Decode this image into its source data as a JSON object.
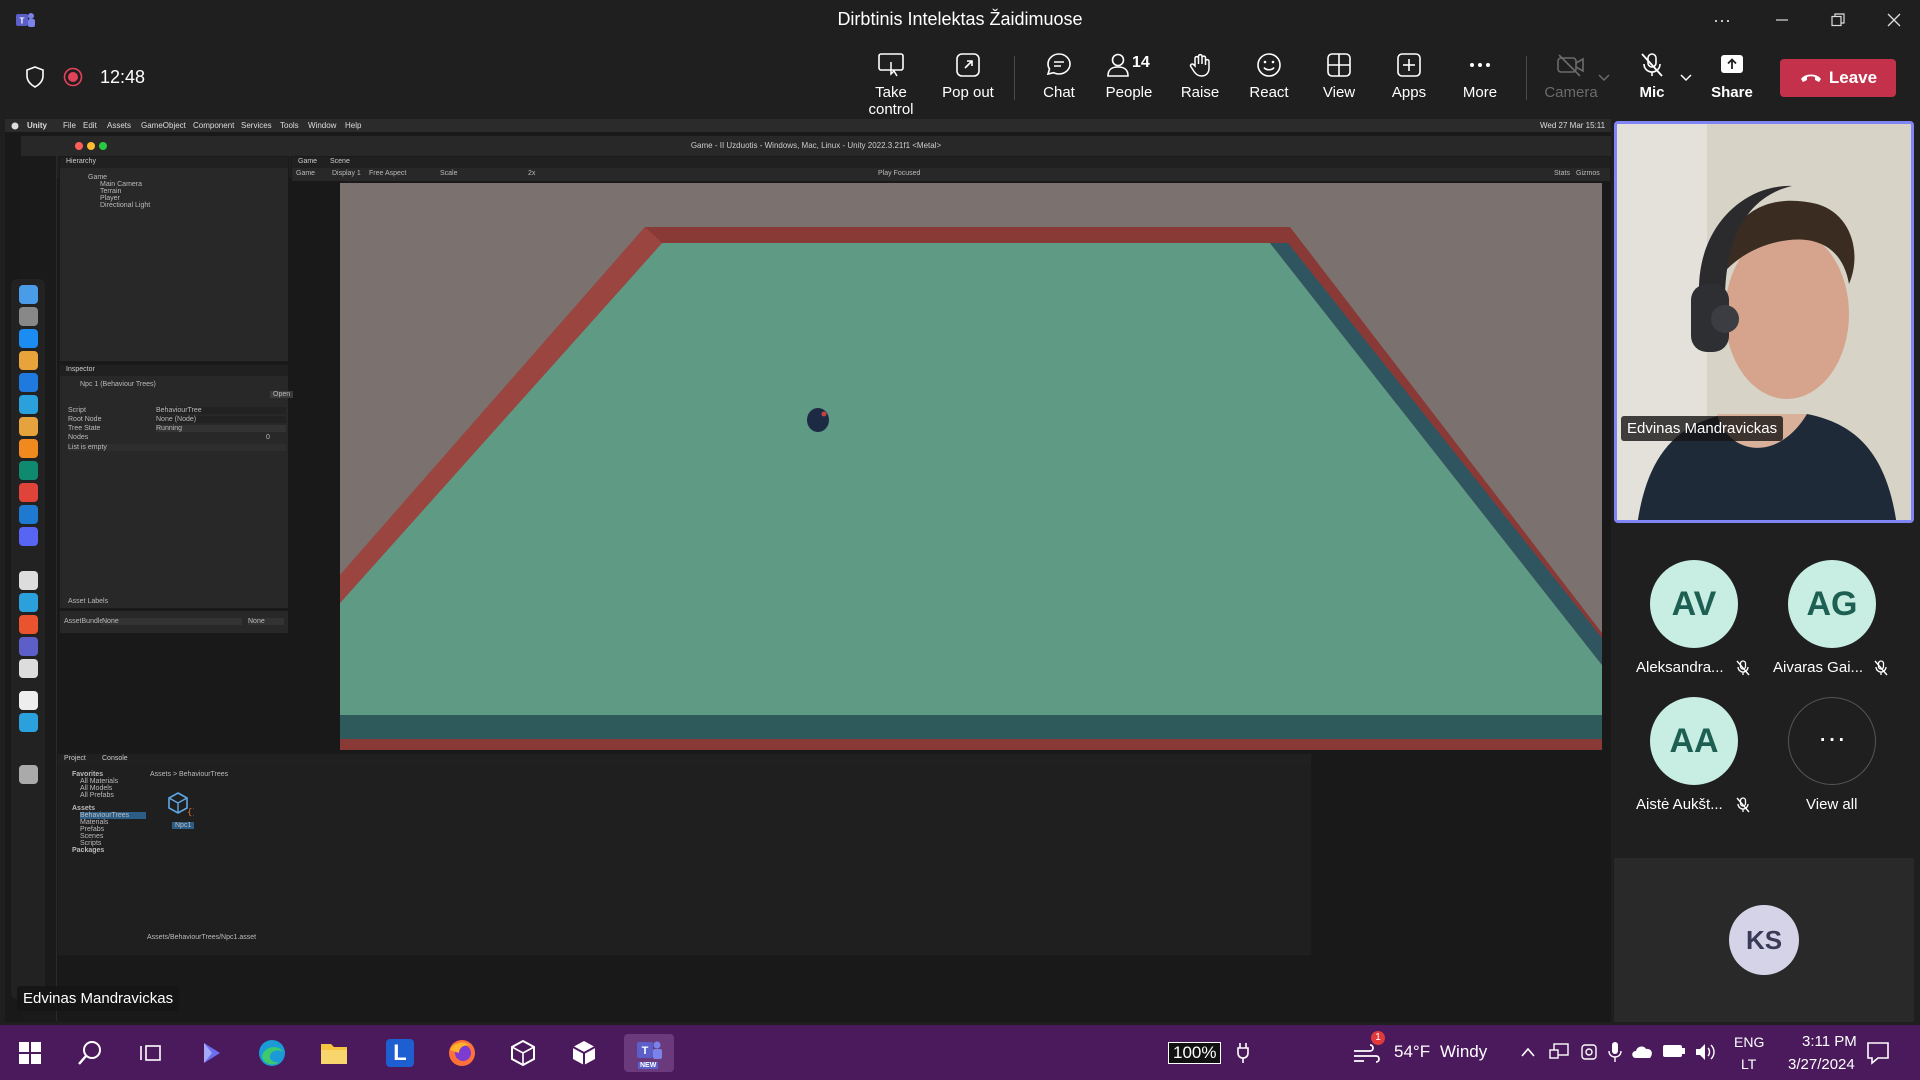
{
  "window": {
    "title": "Dirbtinis Intelektas Žaidimuose",
    "more_label": "···"
  },
  "meeting": {
    "elapsed": "12:48",
    "people_count": "14"
  },
  "toolbar": {
    "take_control": "Take control",
    "pop_out": "Pop out",
    "chat": "Chat",
    "people": "People",
    "raise": "Raise",
    "react": "React",
    "view": "View",
    "apps": "Apps",
    "more": "More",
    "camera": "Camera",
    "mic": "Mic",
    "share": "Share",
    "leave": "Leave"
  },
  "shared_screen": {
    "presenter_name": "Edvinas Mandravickas",
    "mac_menu": [
      "Unity",
      "File",
      "Edit",
      "Assets",
      "GameObject",
      "Component",
      "Services",
      "Tools",
      "Window",
      "Help"
    ],
    "mac_clock": "Wed 27 Mar 15:11",
    "unity_title": "Game - II Uzduotis - Windows, Mac, Linux - Unity 2022.3.21f1 <Metal>",
    "hierarchy_tab": "Hierarchy",
    "hierarchy_items": [
      "Game",
      "Main Camera",
      "Terrain",
      "Player",
      "Directional Light"
    ],
    "scene_tab": "Scene",
    "game_tab": "Game",
    "game_toolbar": [
      "Game",
      "Display 1",
      "Free Aspect",
      "Scale",
      "2x",
      "Play Focused",
      "Stats",
      "Gizmos"
    ],
    "inspector_tab": "Inspector",
    "inspector_title": "Npc 1 (Behaviour Trees)",
    "inspector_open": "Open",
    "inspector_fields": [
      {
        "label": "Script",
        "value": "BehaviourTree"
      },
      {
        "label": "Root Node",
        "value": "None (Node)"
      },
      {
        "label": "Tree State",
        "value": "Running"
      },
      {
        "label": "Nodes",
        "value": "0"
      }
    ],
    "inspector_empty": "List is empty",
    "asset_labels": "Asset Labels",
    "asset_bundle_label": "AssetBundle",
    "asset_bundle_value": "None",
    "asset_bundle_variant": "None",
    "project_tab": "Project",
    "console_tab": "Console",
    "project_tree": [
      "Favorites",
      "All Materials",
      "All Models",
      "All Prefabs",
      "Assets",
      "BehaviourTrees",
      "Materials",
      "Prefabs",
      "Scenes",
      "Scripts",
      "Packages"
    ],
    "breadcrumb": [
      "Assets",
      "BehaviourTrees"
    ],
    "asset_item": "Npc1",
    "status_path": "Assets/BehaviourTrees/Npc1.asset"
  },
  "participants": {
    "featured": "Edvinas Mandravickas",
    "grid": [
      {
        "initials": "AV",
        "name": "Aleksandra..."
      },
      {
        "initials": "AG",
        "name": "Aivaras Gai..."
      },
      {
        "initials": "AA",
        "name": "Aistė Aukšt..."
      }
    ],
    "view_all": "View all",
    "extra_initials": "KS"
  },
  "taskbar": {
    "battery": "100%",
    "weather_temp": "54°F",
    "weather_desc": "Windy",
    "weather_badge": "1",
    "lang_top": "ENG",
    "lang_bottom": "LT",
    "time": "3:11 PM",
    "date": "3/27/2024",
    "l_app_letter": "L",
    "new_badge": "NEW"
  },
  "colors": {
    "accent": "#7f85f5",
    "leave": "#c4314b",
    "taskbar": "#4b1a5c",
    "avatar_bg": "#c8ede2",
    "game_floor": "#5e9a84",
    "game_wall": "#8a3a36"
  }
}
